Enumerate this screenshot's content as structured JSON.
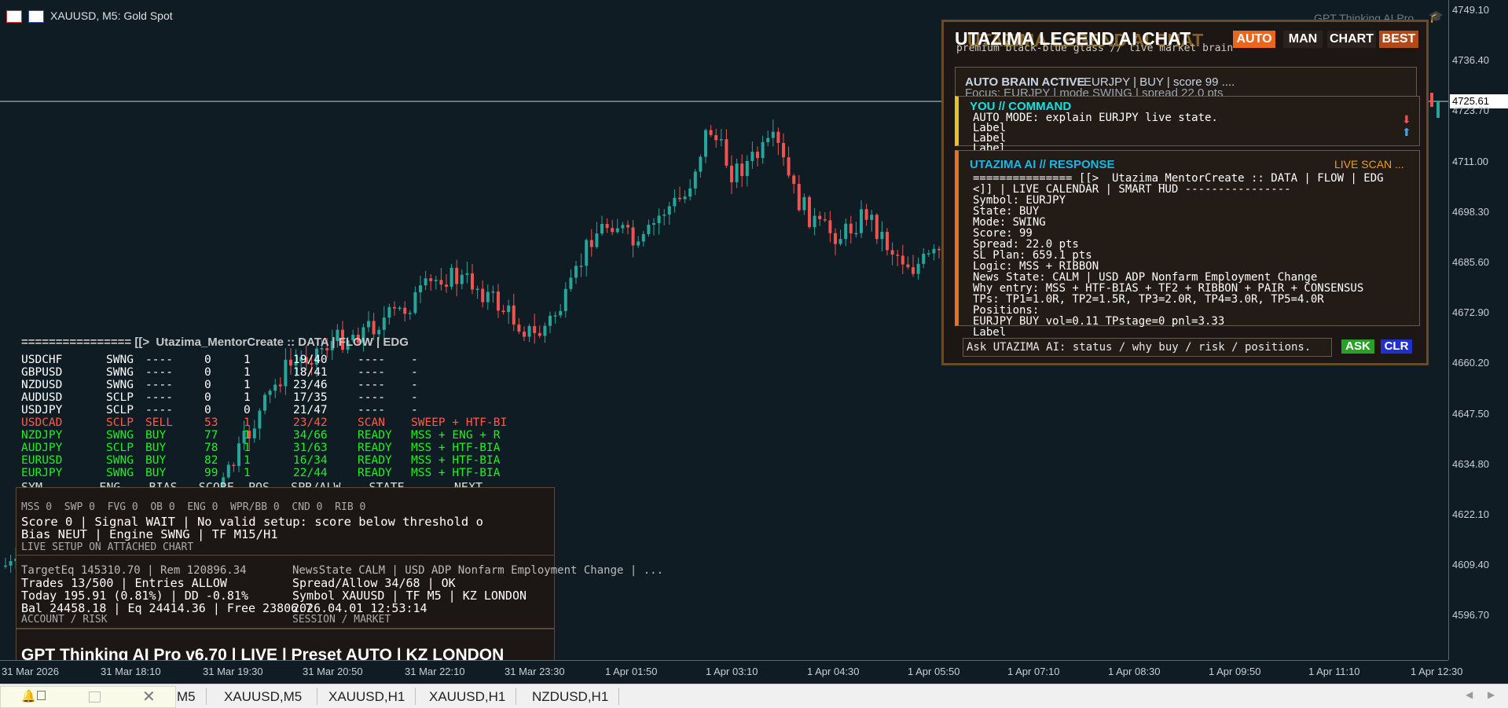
{
  "chart": {
    "symbol_title": "XAUUSD, M5:  Gold Spot",
    "watermark": "GPT Thinking AI Pro",
    "current_price": "4725.61",
    "price_levels": [
      "4749.10",
      "4736.40",
      "4723.70",
      "4711.00",
      "4698.30",
      "4685.60",
      "4672.90",
      "4660.20",
      "4647.50",
      "4634.80",
      "4622.10",
      "4609.40",
      "4596.70"
    ],
    "time_labels": [
      "31 Mar 2026",
      "31 Mar 18:10",
      "31 Mar 19:30",
      "31 Mar 20:50",
      "31 Mar 22:10",
      "31 Mar 23:30",
      "1 Apr 01:50",
      "1 Apr 03:10",
      "1 Apr 04:30",
      "1 Apr 05:50",
      "1 Apr 07:10",
      "1 Apr 08:30",
      "1 Apr 09:50",
      "1 Apr 11:10",
      "1 Apr 12:30"
    ],
    "colors": {
      "bull": "#26a69a",
      "bear": "#ef5350",
      "background": "#0f1c24"
    }
  },
  "tabs": {
    "items": [
      "M5",
      "XAUUSD,M5",
      "XAUUSD,H1",
      "XAUUSD,H1",
      "NZDUSD,H1"
    ]
  },
  "dashboard": {
    "header": "================ [[>  Utazima_MentorCreate :: DATA | FLOW | EDG",
    "rows": [
      {
        "sym": "USDCHF",
        "eng": "SWNG",
        "bias": "----",
        "score": "0",
        "pos": "1",
        "spr": "19/40",
        "state": "----",
        "next": "-",
        "color": "#ffffff"
      },
      {
        "sym": "GBPUSD",
        "eng": "SWNG",
        "bias": "----",
        "score": "0",
        "pos": "1",
        "spr": "18/41",
        "state": "----",
        "next": "-",
        "color": "#ffffff"
      },
      {
        "sym": "NZDUSD",
        "eng": "SWNG",
        "bias": "----",
        "score": "0",
        "pos": "1",
        "spr": "23/46",
        "state": "----",
        "next": "-",
        "color": "#ffffff"
      },
      {
        "sym": "AUDUSD",
        "eng": "SCLP",
        "bias": "----",
        "score": "0",
        "pos": "1",
        "spr": "17/35",
        "state": "----",
        "next": "-",
        "color": "#ffffff"
      },
      {
        "sym": "USDJPY",
        "eng": "SCLP",
        "bias": "----",
        "score": "0",
        "pos": "0",
        "spr": "21/47",
        "state": "----",
        "next": "-",
        "color": "#ffffff"
      },
      {
        "sym": "USDCAD",
        "eng": "SCLP",
        "bias": "SELL",
        "score": "53",
        "pos": "1",
        "spr": "23/42",
        "state": "SCAN",
        "next": "SWEEP + HTF-BI",
        "color": "#ff5a4a"
      },
      {
        "sym": "NZDJPY",
        "eng": "SWNG",
        "bias": "BUY",
        "score": "77",
        "pos": "1",
        "spr": "34/66",
        "state": "READY",
        "next": "MSS + ENG + R",
        "color": "#22ee22"
      },
      {
        "sym": "AUDJPY",
        "eng": "SCLP",
        "bias": "BUY",
        "score": "78",
        "pos": "1",
        "spr": "31/63",
        "state": "READY",
        "next": "MSS + HTF-BIA",
        "color": "#22ee22"
      },
      {
        "sym": "EURUSD",
        "eng": "SWNG",
        "bias": "BUY",
        "score": "82",
        "pos": "1",
        "spr": "16/34",
        "state": "READY",
        "next": "MSS + HTF-BIA",
        "color": "#22ee22"
      },
      {
        "sym": "EURJPY",
        "eng": "SWNG",
        "bias": "BUY",
        "score": "99",
        "pos": "1",
        "spr": "22/44",
        "state": "READY",
        "next": "MSS + HTF-BIA",
        "color": "#22ee22"
      }
    ],
    "columns": "SYM        ENG    BIAS   SCORE  POS   SPR/ALW    STATE       NEXT",
    "flags": "MSS 0  SWP 0  FVG 0  OB 0  ENG 0  WPR/BB 0  CND 0  RIB 0",
    "signal_line1": "Score 0 | Signal WAIT | No valid setup: score below threshold o",
    "signal_line2": "Bias NEUT | Engine SWNG | TF M15/H1",
    "live_setup": "LIVE SETUP ON ATTACHED CHART",
    "target_line": "TargetEq 145310.70 | Rem 120896.34",
    "trades_line": "Trades 13/500 | Entries ALLOW",
    "today_line": "Today 195.91 (0.81%) | DD -0.81%",
    "bal_line": "Bal 24458.18 | Eq 24414.36 | Free 23806.7",
    "account_title": "ACCOUNT / RISK",
    "news_line": "NewsState CALM | USD ADP Nonfarm Employment Change | ...",
    "spread_line": "Spread/Allow 34/68 | OK",
    "symbol_line": "Symbol XAUUSD | TF M5 | KZ LONDON",
    "date_line": "2026.04.01 12:53:14",
    "session_title": "SESSION / MARKET",
    "footer": "GPT Thinking AI Pro v6.70 | LIVE | Preset AUTO | KZ LONDON"
  },
  "chat": {
    "title": "UTAZIMA LEGEND AI CHAT",
    "title_ghost": "UTAZIMA LEGEND AI CHAT",
    "subtitle": "premium black-blue glass // live market brain",
    "buttons": {
      "auto": "AUTO",
      "man": "MAN",
      "chart": "CHART",
      "best": "BEST",
      "ask": "ASK",
      "clr": "CLR"
    },
    "brain_title": "AUTO BRAIN ACTIVE",
    "brain_info": "EURJPY | BUY | score 99  ....",
    "focus": "Focus: EURJPY | mode SWING | spread 22.0 pts",
    "you_title": "YOU // COMMAND",
    "command": "AUTO MODE: explain EURJPY live state.",
    "labels": [
      "Label",
      "Label",
      "Label",
      "Label"
    ],
    "resp_title": "UTAZIMA AI // RESPONSE",
    "live_scan": "LIVE SCAN ...",
    "response_lines": [
      "=============== [[>  Utazima_MentorCreate :: DATA | FLOW | EDG",
      "<]] | LIVE CALENDAR | SMART HUD ----------------",
      "Symbol: EURJPY",
      "State: BUY",
      "Mode: SWING",
      "Score: 99",
      "Spread: 22.0 pts",
      "SL Plan: 659.1 pts",
      "Logic: MSS + RIBBON",
      "News State: CALM | USD ADP Nonfarm Employment Change",
      "Why entry: MSS + HTF-BIAS + TF2 + RIBBON + PAIR + CONSENSUS",
      "TPs: TP1=1.0R, TP2=1.5R, TP3=2.0R, TP4=3.0R, TP5=4.0R",
      "Positions:",
      "EURJPY BUY vol=0.11 TPstage=0 pnl=3.33"
    ],
    "ask_placeholder": "Ask UTAZIMA AI: status / why buy / risk / positions."
  }
}
